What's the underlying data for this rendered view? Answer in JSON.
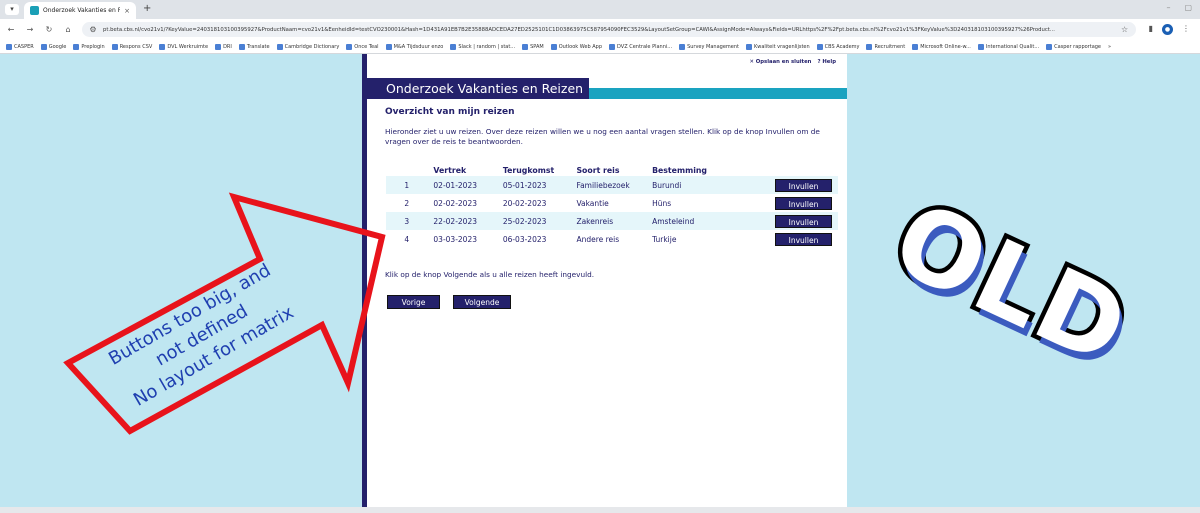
{
  "browser": {
    "tab_title": "Onderzoek Vakanties en Reizen",
    "tab_close": "×",
    "new_tab": "+",
    "url": "pt.beta.cbs.nl/cvo21v1/?KeyValue=240318103100395927&ProductNaam=cvo21v1&EenheidId=testCVO230001&Hash=1D431A91EB7B2E35888ADCEDA27ED2525101C1D03863975C587954090FEC3529&LayoutSetGroup=CAWI&AssignMode=Always&Fields=URLhttps%2F%2Fpt.beta.cbs.nl%2Fcvo21v1%3FKeyValue%3D240318103100395927%26Product...",
    "bookmarks": [
      "CASPER",
      "Google",
      "Preplogin",
      "Respons CSV",
      "DVL Werkruimte",
      "DRI",
      "Translate",
      "Cambridge Dictionary",
      "Once Teal",
      "M&A Tijdsduur enzo",
      "Slack | random | stat...",
      "SPAM",
      "Outlook Web App",
      "DVZ Centrale Planni...",
      "Survey Management",
      "Kwaliteit vragenlijsten",
      "CBS Academy",
      "Recruitment",
      "Microsoft Online-w...",
      "International Qualit...",
      "Casper rapportage"
    ],
    "bookmarks_more": "»"
  },
  "survey": {
    "top_links": [
      "Opslaan en sluiten",
      "Help"
    ],
    "banner_title": "Onderzoek Vakanties en Reizen",
    "section_title": "Overzicht van mijn reizen",
    "intro": "Hieronder ziet u uw reizen. Over deze reizen willen we u nog een aantal vragen stellen. Klik op de knop Invullen om de vragen over de reis te beantwoorden.",
    "headers": [
      "",
      "Vertrek",
      "Terugkomst",
      "Soort reis",
      "Bestemming"
    ],
    "rows": [
      {
        "index": "1",
        "departure": "02-01-2023",
        "return": "05-01-2023",
        "type": "Familiebezoek",
        "destination": "Burundi",
        "button": "Invullen"
      },
      {
        "index": "2",
        "departure": "02-02-2023",
        "return": "20-02-2023",
        "type": "Vakantie",
        "destination": "Hüns",
        "button": "Invullen"
      },
      {
        "index": "3",
        "departure": "22-02-2023",
        "return": "25-02-2023",
        "type": "Zakenreis",
        "destination": "Amsteleind",
        "button": "Invullen"
      },
      {
        "index": "4",
        "departure": "03-03-2023",
        "return": "06-03-2023",
        "type": "Andere reis",
        "destination": "Turkije",
        "button": "Invullen"
      }
    ],
    "footer_text": "Klik op de knop Volgende als u alle reizen heeft ingevuld.",
    "prev_button": "Vorige",
    "next_button": "Volgende"
  },
  "annotation": {
    "line1": "Buttons too big, and",
    "line2": "not defined",
    "line3": "No layout for matrix",
    "stamp": "OLD",
    "arrow_color": "#e8131b",
    "text_color": "#1f3fb0"
  },
  "colors": {
    "brand_navy": "#24216b",
    "brand_teal": "#1aa3c0",
    "background": "#bfe6f1",
    "row_stripe": "#e5f6fa"
  }
}
